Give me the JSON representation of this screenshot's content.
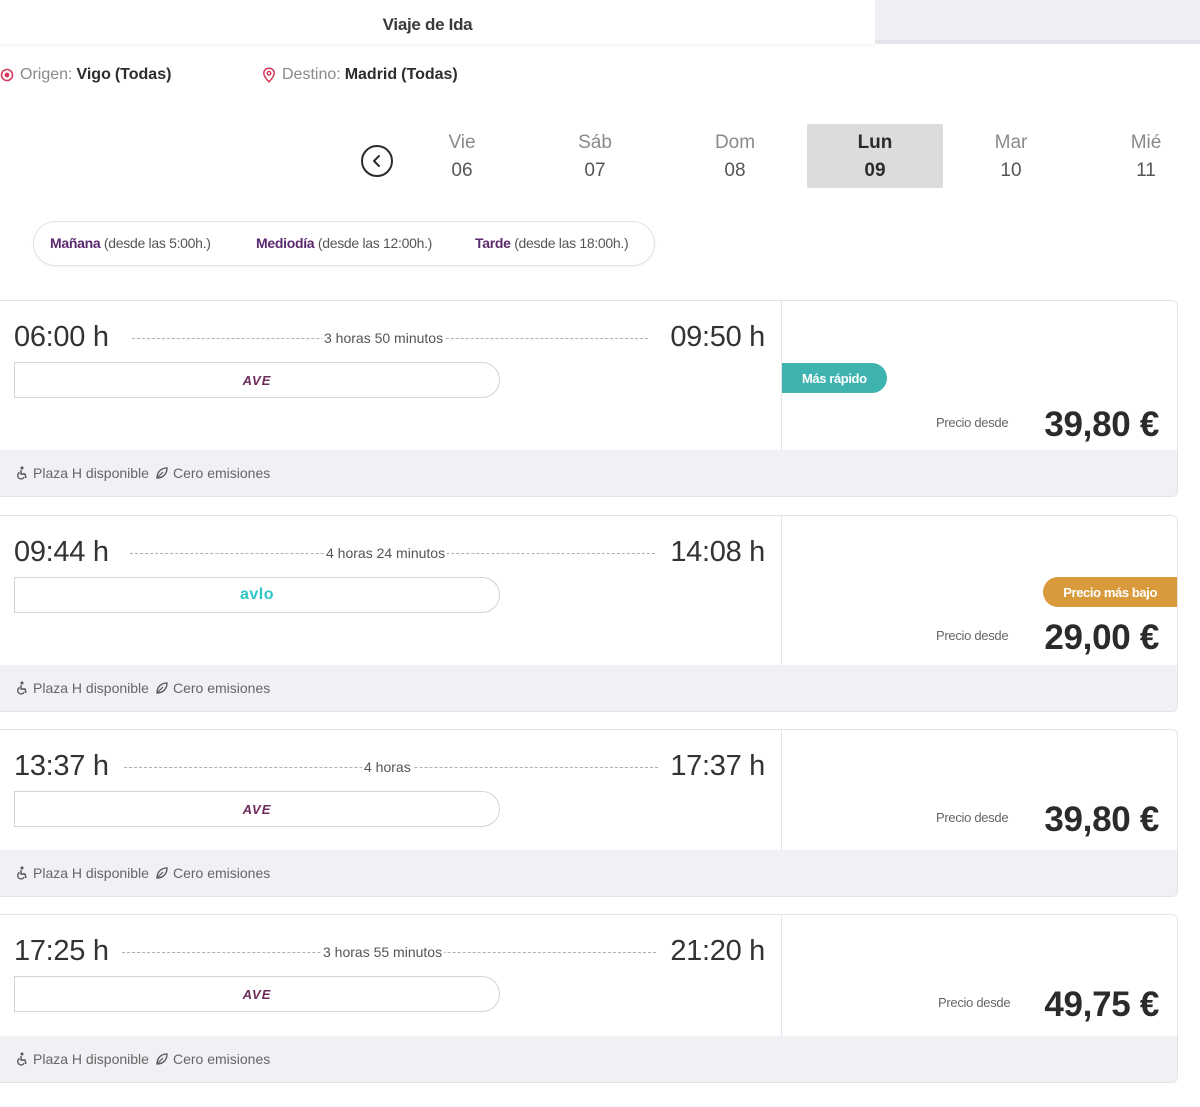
{
  "tabs": {
    "outbound_label": "Viaje de Ida"
  },
  "route": {
    "origin_label": "Origen:",
    "origin_value": "Vigo",
    "origin_sub": "(Todas)",
    "destination_label": "Destino:",
    "destination_value": "Madrid",
    "destination_sub": "(Todas)"
  },
  "dates": [
    {
      "day": "Vie",
      "num": "06",
      "selected": false
    },
    {
      "day": "Sáb",
      "num": "07",
      "selected": false
    },
    {
      "day": "Dom",
      "num": "08",
      "selected": false
    },
    {
      "day": "Lun",
      "num": "09",
      "selected": true
    },
    {
      "day": "Mar",
      "num": "10",
      "selected": false
    },
    {
      "day": "Mié",
      "num": "11",
      "selected": false
    }
  ],
  "filters": [
    {
      "label": "Mañana",
      "sub": "(desde las 5:00h.)"
    },
    {
      "label": "Mediodía",
      "sub": "(desde las 12:00h.)"
    },
    {
      "label": "Tarde",
      "sub": "(desde las 18:00h.)"
    }
  ],
  "trip_common": {
    "price_label": "Precio desde",
    "accessible": "Plaza H disponible",
    "eco": "Cero emisiones"
  },
  "trips": [
    {
      "depart": "06:00 h",
      "arrive": "09:50 h",
      "duration": "3 horas 50 minutos",
      "brand": "AVE",
      "price": "39,80 €",
      "badge": "Más rápido"
    },
    {
      "depart": "09:44 h",
      "arrive": "14:08 h",
      "duration": "4 horas 24 minutos",
      "brand": "avlo",
      "price": "29,00 €",
      "badge": "Precio más bajo"
    },
    {
      "depart": "13:37 h",
      "arrive": "17:37 h",
      "duration": "4 horas",
      "brand": "AVE",
      "price": "39,80 €",
      "badge": ""
    },
    {
      "depart": "17:25 h",
      "arrive": "21:20 h",
      "duration": "3 horas 55 minutos",
      "brand": "AVE",
      "price": "49,75 €",
      "badge": ""
    }
  ],
  "colors": {
    "brand_purple": "#5a2a6e",
    "badge_fast": "#3fb3b0",
    "badge_low": "#d89a3b",
    "avlo": "#2ec4c4",
    "pin_red": "#d23a5a"
  }
}
